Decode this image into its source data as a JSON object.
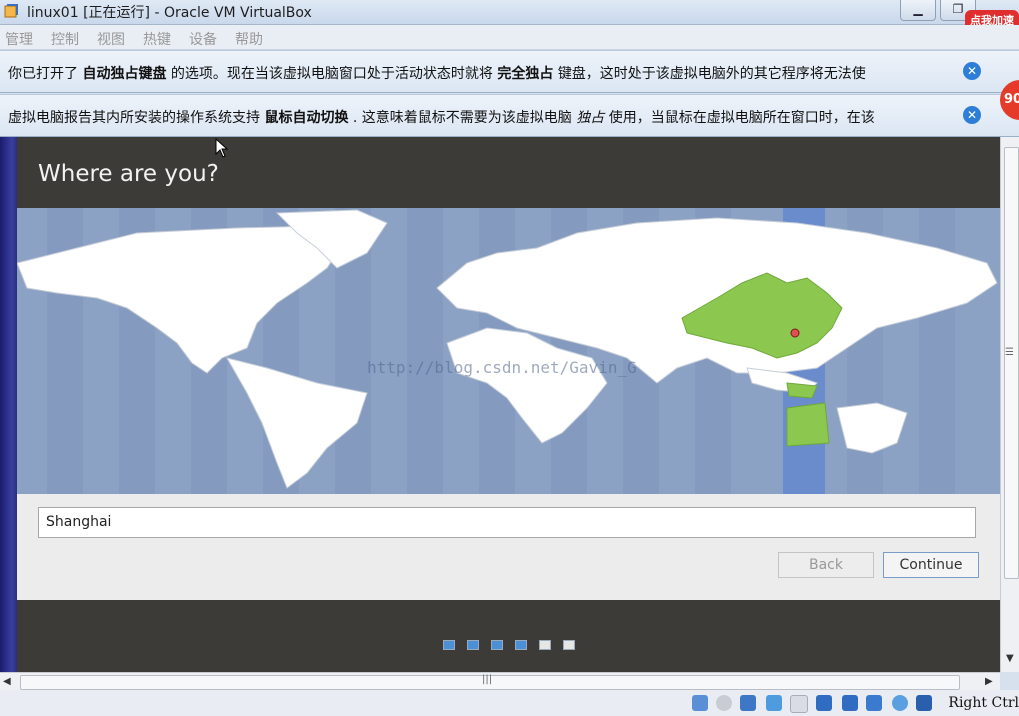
{
  "window": {
    "title": "linux01 [正在运行] - Oracle VM VirtualBox",
    "minimize_label": "▁",
    "restore_label": "❐",
    "promo_badge": "点我加速",
    "promo_number": "90"
  },
  "menubar": {
    "items": [
      "管理",
      "控制",
      "视图",
      "热键",
      "设备",
      "帮助"
    ]
  },
  "notices": [
    {
      "before": "你已打开了",
      "bold1": "自动独占键盘",
      "middle": "的选项。现在当该虚拟电脑窗口处于活动状态时就将",
      "bold2": "完全独占",
      "after": "键盘，这时处于该虚拟电脑外的其它程序将无法使"
    },
    {
      "before": "虚拟电脑报告其内所安装的操作系统支持",
      "bold1": "鼠标自动切换",
      "middle": ". 这意味着鼠标不需要为该虚拟电脑",
      "italic": "独占",
      "after": "使用，当鼠标在虚拟电脑所在窗口时，在该"
    }
  ],
  "installer": {
    "heading": "Where are you?",
    "timezone_value": "Shanghai",
    "back_label": "Back",
    "continue_label": "Continue",
    "watermark": "http://blog.csdn.net/Gavin_G"
  },
  "progress": {
    "steps_total": 6,
    "steps_completed": 4
  },
  "statusbar": {
    "host_key": "Right Ctrl",
    "icons": [
      "hard-disk-icon",
      "optical-disk-icon",
      "usb-icon",
      "shared-folder-icon",
      "display-icon",
      "network-icon",
      "network-adapter-icon",
      "virtualization-icon",
      "mouse-integration-icon",
      "keyboard-capture-icon"
    ]
  },
  "colors": {
    "map_water": "#8ca2c4",
    "map_land": "#ffffff",
    "selected_region": "#8cc84f",
    "header_bg": "#3c3b37",
    "progress_done": "#4d8fd6"
  }
}
